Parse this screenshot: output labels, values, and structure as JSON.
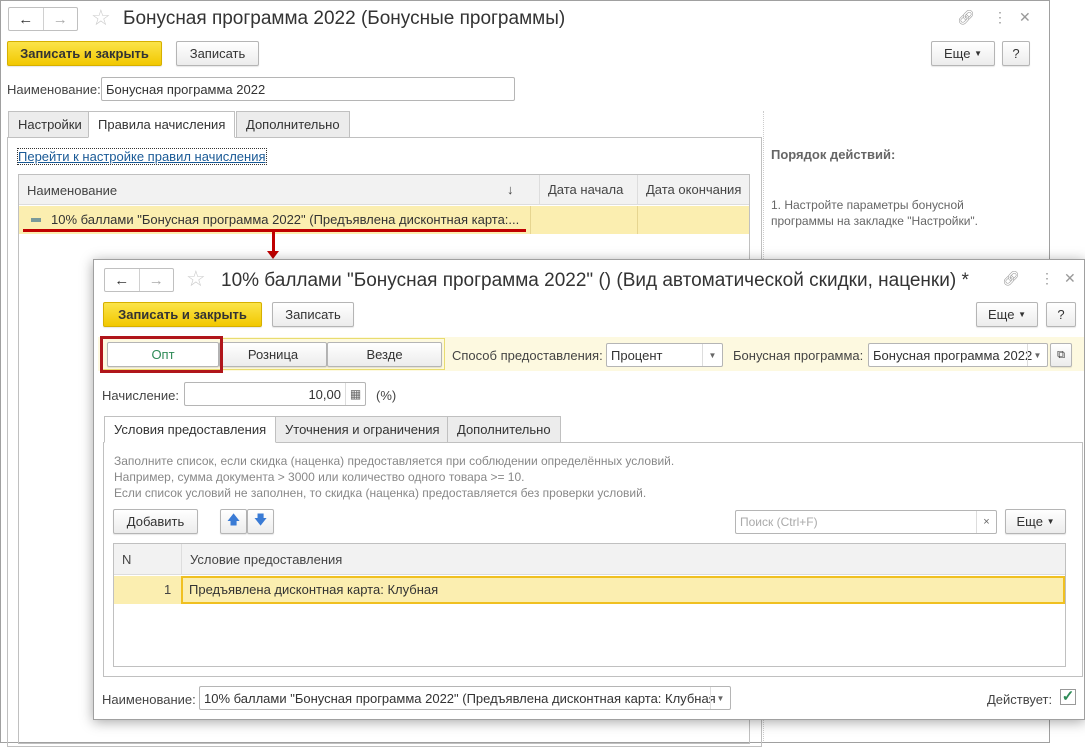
{
  "main_window": {
    "title": "Бонусная программа 2022 (Бонусные программы)",
    "save_close": "Записать и закрыть",
    "save": "Записать",
    "more": "Еще",
    "help": "?",
    "name_label": "Наименование:",
    "name_value": "Бонусная программа 2022",
    "tabs": [
      "Настройки",
      "Правила начисления",
      "Дополнительно"
    ],
    "link": "Перейти к настройке правил начисления",
    "columns": [
      "Наименование",
      "Дата начала",
      "Дата окончания"
    ],
    "rows": [
      {
        "name": "10% баллами \"Бонусная программа 2022\" (Предъявлена дисконтная карта:...",
        "start": "",
        "end": ""
      }
    ],
    "sidebar": {
      "heading": "Порядок действий:",
      "step": "1. Настройте параметры бонусной программы на закладке \"Настройки\"."
    }
  },
  "dialog": {
    "title": "10% баллами \"Бонусная программа 2022\" () (Вид автоматической скидки, наценки) *",
    "save_close": "Записать и закрыть",
    "save": "Записать",
    "more": "Еще",
    "help": "?",
    "segments": [
      "Опт",
      "Розница",
      "Везде"
    ],
    "method_label": "Способ предоставления:",
    "method_value": "Процент",
    "program_label": "Бонусная программа:",
    "program_value": "Бонусная программа 2022",
    "accrual_label": "Начисление:",
    "accrual_value": "10,00",
    "accrual_unit": "(%)",
    "tabs": [
      "Условия предоставления",
      "Уточнения и ограничения",
      "Дополнительно"
    ],
    "hint": [
      "Заполните список, если скидка (наценка) предоставляется при соблюдении определённых условий.",
      "Например, сумма документа > 3000 или количество одного товара >= 10.",
      "Если список условий не заполнен, то скидка (наценка) предоставляется без проверки условий."
    ],
    "add": "Добавить",
    "search_placeholder": "Поиск (Ctrl+F)",
    "more2": "Еще",
    "columns": [
      "N",
      "Условие предоставления"
    ],
    "rows": [
      {
        "n": "1",
        "condition": "Предъявлена дисконтная карта: Клубная"
      }
    ],
    "name_label": "Наименование:",
    "name_value": "10% баллами \"Бонусная программа 2022\" (Предъявлена дисконтная карта: Клубная",
    "active_label": "Действует:",
    "active": true
  },
  "colors": {
    "accent_yellow": "#f5d000",
    "highlight_row": "#fbeeb0",
    "annotation_red": "#c00000",
    "active_green": "#2e8b57"
  }
}
